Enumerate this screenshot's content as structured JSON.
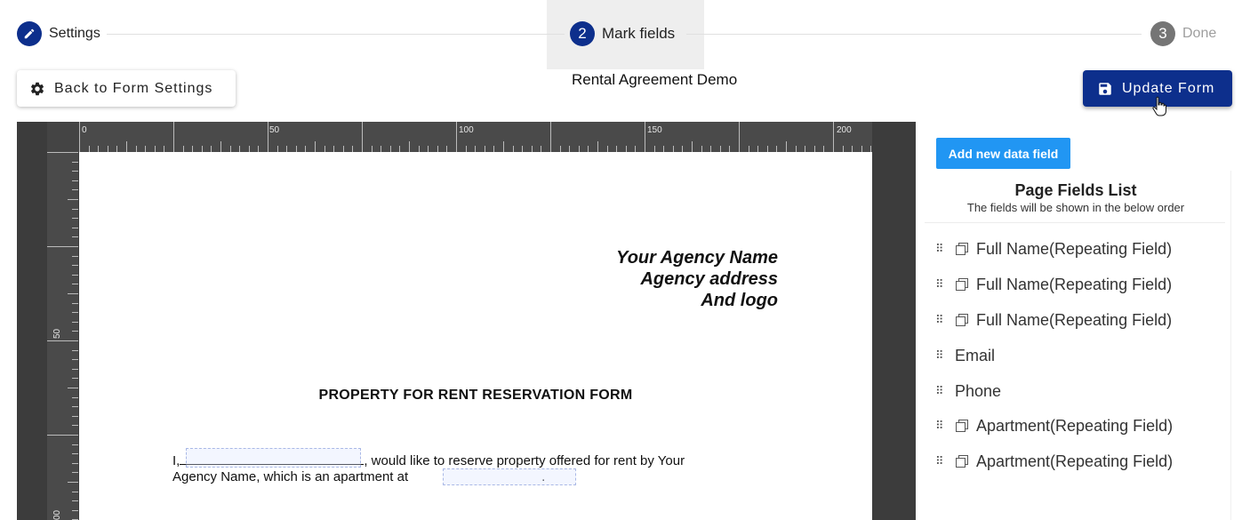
{
  "stepper": {
    "steps": [
      {
        "number": "",
        "label": "Settings",
        "icon": "pencil-icon",
        "state": "complete"
      },
      {
        "number": "2",
        "label": "Mark fields",
        "state": "active"
      },
      {
        "number": "3",
        "label": "Done",
        "state": "pending"
      }
    ]
  },
  "header": {
    "back_label": "Back to Form Settings",
    "form_title": "Rental Agreement Demo",
    "update_label": "Update Form"
  },
  "rulers": {
    "top_labels": [
      "0",
      "50",
      "100",
      "150",
      "200"
    ],
    "left_labels": [
      "50",
      "00"
    ]
  },
  "document": {
    "agency_lines": [
      "Your Agency Name",
      "Agency address",
      "And logo"
    ],
    "title": "PROPERTY FOR RENT RESERVATION FORM",
    "para_start": "I,",
    "para_after_field": ", would like to reserve property offered for rent by Your",
    "para_line2": "Agency Name, which is an apartment at",
    "para_end": "."
  },
  "panel": {
    "add_button": "Add new data field",
    "title": "Page Fields List",
    "subtitle": "The fields will be shown in the below order",
    "fields": [
      {
        "label": "Full Name(Repeating Field)",
        "repeating": true
      },
      {
        "label": "Full Name(Repeating Field)",
        "repeating": true
      },
      {
        "label": "Full Name(Repeating Field)",
        "repeating": true
      },
      {
        "label": "Email",
        "repeating": false
      },
      {
        "label": "Phone",
        "repeating": false
      },
      {
        "label": "Apartment(Repeating Field)",
        "repeating": true
      },
      {
        "label": "Apartment(Repeating Field)",
        "repeating": true
      }
    ]
  },
  "colors": {
    "primary": "#0d2f8c",
    "accent": "#2196f3",
    "step_pending": "#757575",
    "canvas_bg": "#3c3c3c"
  }
}
